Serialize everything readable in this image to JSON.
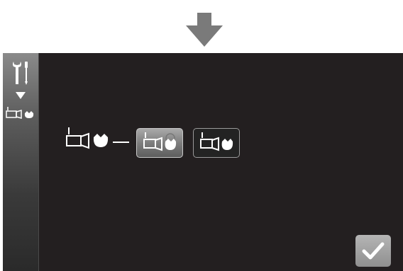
{
  "top_arrow": {
    "icon": "down-arrow-icon",
    "color": "#7a7a7a"
  },
  "sidebar": {
    "icons": [
      "tools-icon",
      "chevron-down-icon",
      "indicator-mode-icon"
    ],
    "background": "#5c5c5c"
  },
  "options": {
    "static_icon": "indicator-mode-icon",
    "items": [
      {
        "icon": "indicator-mode-icon",
        "selected": true
      },
      {
        "icon": "indicator-mode-icon",
        "selected": false
      }
    ]
  },
  "confirm": {
    "icon": "checkmark-icon"
  },
  "colors": {
    "screen_bg": "#231f20",
    "icon_white": "#ffffff"
  }
}
